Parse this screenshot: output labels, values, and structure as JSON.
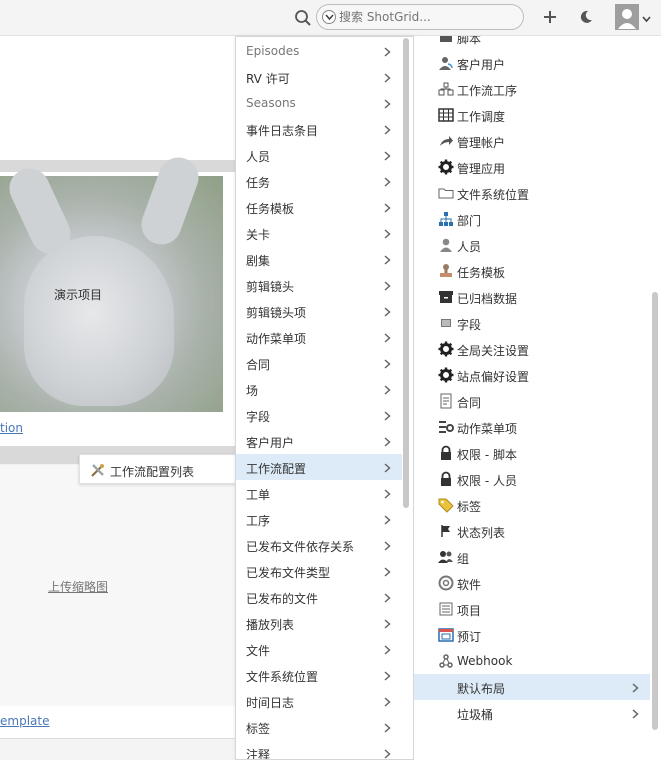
{
  "header": {
    "search_placeholder": "搜索 ShotGrid...",
    "icons": [
      "search-icon",
      "chevron-down-icon",
      "plus-icon",
      "moon-icon",
      "avatar-icon"
    ]
  },
  "background": {
    "thumbnail_label": "演示项目",
    "link_tion": "tion",
    "upload_thumbnail": "上传缩略图",
    "link_template": "emplate"
  },
  "popup": {
    "label": "工作流配置列表",
    "icon": "tools-icon"
  },
  "menu_mid": {
    "items": [
      {
        "label": "Episodes",
        "gray": true
      },
      {
        "label": "RV 许可",
        "gray": false
      },
      {
        "label": "Seasons",
        "gray": true
      },
      {
        "label": "事件日志条目",
        "gray": false
      },
      {
        "label": "人员",
        "gray": false
      },
      {
        "label": "任务",
        "gray": false
      },
      {
        "label": "任务模板",
        "gray": false
      },
      {
        "label": "关卡",
        "gray": false
      },
      {
        "label": "剧集",
        "gray": false
      },
      {
        "label": "剪辑镜头",
        "gray": false
      },
      {
        "label": "剪辑镜头项",
        "gray": false
      },
      {
        "label": "动作菜单项",
        "gray": false
      },
      {
        "label": "合同",
        "gray": false
      },
      {
        "label": "场",
        "gray": false
      },
      {
        "label": "字段",
        "gray": false
      },
      {
        "label": "客户用户",
        "gray": false
      },
      {
        "label": "工作流配置",
        "gray": false,
        "active": true
      },
      {
        "label": "工单",
        "gray": false
      },
      {
        "label": "工序",
        "gray": false
      },
      {
        "label": "已发布文件依存关系",
        "gray": false
      },
      {
        "label": "已发布文件类型",
        "gray": false
      },
      {
        "label": "已发布的文件",
        "gray": false
      },
      {
        "label": "播放列表",
        "gray": false
      },
      {
        "label": "文件",
        "gray": false
      },
      {
        "label": "文件系统位置",
        "gray": false
      },
      {
        "label": "时间日志",
        "gray": false
      },
      {
        "label": "标签",
        "gray": false
      },
      {
        "label": "注释",
        "gray": false
      }
    ]
  },
  "menu_right": {
    "items": [
      {
        "label": "脚本",
        "icon": "script-icon"
      },
      {
        "label": "客户用户",
        "icon": "client-user-icon"
      },
      {
        "label": "工作流工序",
        "icon": "pipeline-step-icon"
      },
      {
        "label": "工作调度",
        "icon": "calendar-grid-icon"
      },
      {
        "label": "管理帐户",
        "icon": "share-arrow-icon"
      },
      {
        "label": "管理应用",
        "icon": "gear-icon"
      },
      {
        "label": "文件系统位置",
        "icon": "folder-icon"
      },
      {
        "label": "部门",
        "icon": "org-chart-icon"
      },
      {
        "label": "人员",
        "icon": "person-icon"
      },
      {
        "label": "任务模板",
        "icon": "stamp-icon"
      },
      {
        "label": "已归档数据",
        "icon": "archive-icon"
      },
      {
        "label": "字段",
        "icon": "field-icon"
      },
      {
        "label": "全局关注设置",
        "icon": "gear-icon"
      },
      {
        "label": "站点偏好设置",
        "icon": "gear-icon"
      },
      {
        "label": "合同",
        "icon": "contract-icon"
      },
      {
        "label": "动作菜单项",
        "icon": "action-menu-icon"
      },
      {
        "label": "权限 - 脚本",
        "icon": "lock-icon"
      },
      {
        "label": "权限 - 人员",
        "icon": "lock-icon"
      },
      {
        "label": "标签",
        "icon": "tag-icon"
      },
      {
        "label": "状态列表",
        "icon": "flag-icon"
      },
      {
        "label": "组",
        "icon": "group-icon"
      },
      {
        "label": "软件",
        "icon": "disc-icon"
      },
      {
        "label": "项目",
        "icon": "project-icon"
      },
      {
        "label": "预订",
        "icon": "booking-icon"
      },
      {
        "label": "Webhook",
        "icon": "webhook-icon"
      },
      {
        "label": "默认布局",
        "icon": "",
        "active": true,
        "chevron": true
      },
      {
        "label": "垃圾桶",
        "icon": "",
        "chevron": true
      }
    ]
  }
}
